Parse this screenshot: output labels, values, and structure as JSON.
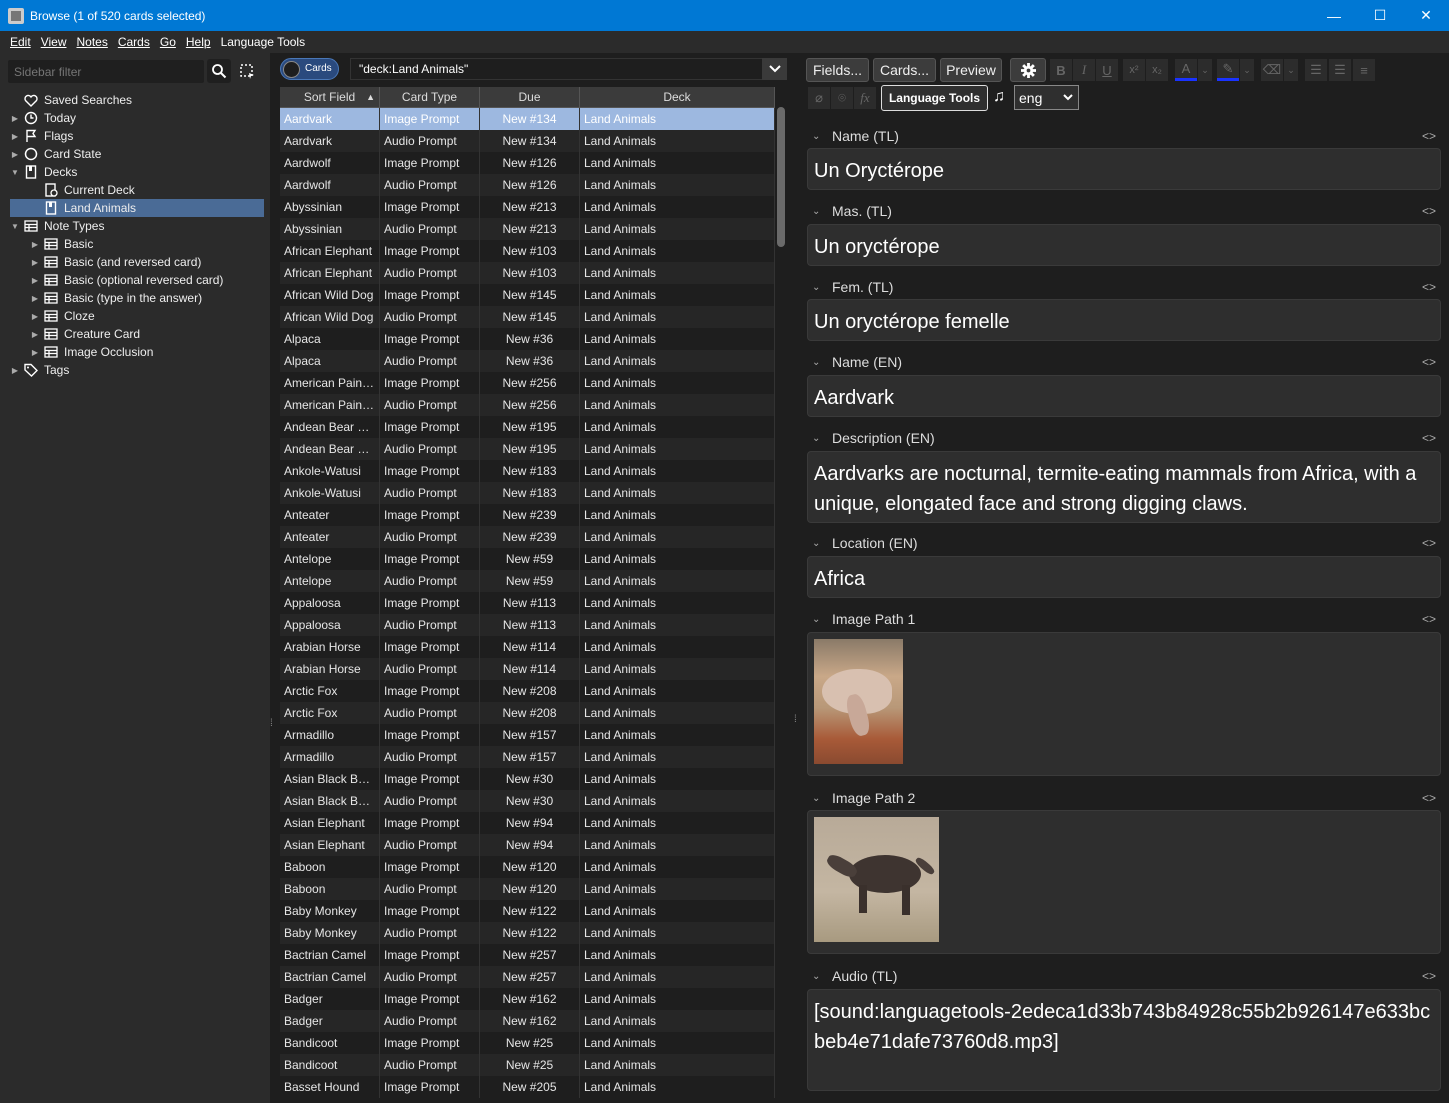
{
  "window": {
    "title": "Browse (1 of 520 cards selected)",
    "minimize": "—",
    "maximize": "☐",
    "close": "✕"
  },
  "menu": [
    "Edit",
    "View",
    "Notes",
    "Cards",
    "Go",
    "Help",
    "Language Tools"
  ],
  "sidebar": {
    "filter_placeholder": "Sidebar filter",
    "items": [
      {
        "label": "Saved Searches",
        "icon": "heart-icon",
        "arrow": "",
        "indent": 0
      },
      {
        "label": "Today",
        "icon": "clock-icon",
        "arrow": "▶",
        "indent": 0
      },
      {
        "label": "Flags",
        "icon": "flag-icon",
        "arrow": "▶",
        "indent": 0
      },
      {
        "label": "Card State",
        "icon": "circle-icon",
        "arrow": "▶",
        "indent": 0
      },
      {
        "label": "Decks",
        "icon": "deck-icon",
        "arrow": "▼",
        "indent": 0
      },
      {
        "label": "Current Deck",
        "icon": "current-deck-icon",
        "arrow": "",
        "indent": 1
      },
      {
        "label": "Land Animals",
        "icon": "deck-icon",
        "arrow": "",
        "indent": 1,
        "selected": true
      },
      {
        "label": "Note Types",
        "icon": "notetype-icon",
        "arrow": "▼",
        "indent": 0
      },
      {
        "label": "Basic",
        "icon": "notetype-icon",
        "arrow": "▶",
        "indent": 1
      },
      {
        "label": "Basic (and reversed card)",
        "icon": "notetype-icon",
        "arrow": "▶",
        "indent": 1
      },
      {
        "label": "Basic (optional reversed card)",
        "icon": "notetype-icon",
        "arrow": "▶",
        "indent": 1
      },
      {
        "label": "Basic (type in the answer)",
        "icon": "notetype-icon",
        "arrow": "▶",
        "indent": 1
      },
      {
        "label": "Cloze",
        "icon": "notetype-icon",
        "arrow": "▶",
        "indent": 1
      },
      {
        "label": "Creature Card",
        "icon": "notetype-icon",
        "arrow": "▶",
        "indent": 1
      },
      {
        "label": "Image Occlusion",
        "icon": "notetype-icon",
        "arrow": "▶",
        "indent": 1
      },
      {
        "label": "Tags",
        "icon": "tag-icon",
        "arrow": "▶",
        "indent": 0
      }
    ]
  },
  "toggle": {
    "label": "Cards"
  },
  "search": {
    "query": "\"deck:Land Animals\""
  },
  "table": {
    "headers": [
      "Sort Field",
      "Card Type",
      "Due",
      "Deck"
    ],
    "sort_indicator": "▲",
    "rows": [
      [
        "Aardvark",
        "Image Prompt",
        "New #134",
        "Land Animals"
      ],
      [
        "Aardvark",
        "Audio Prompt",
        "New #134",
        "Land Animals"
      ],
      [
        "Aardwolf",
        "Image Prompt",
        "New #126",
        "Land Animals"
      ],
      [
        "Aardwolf",
        "Audio Prompt",
        "New #126",
        "Land Animals"
      ],
      [
        "Abyssinian",
        "Image Prompt",
        "New #213",
        "Land Animals"
      ],
      [
        "Abyssinian",
        "Audio Prompt",
        "New #213",
        "Land Animals"
      ],
      [
        "African Elephant",
        "Image Prompt",
        "New #103",
        "Land Animals"
      ],
      [
        "African Elephant",
        "Audio Prompt",
        "New #103",
        "Land Animals"
      ],
      [
        "African Wild Dog",
        "Image Prompt",
        "New #145",
        "Land Animals"
      ],
      [
        "African Wild Dog",
        "Audio Prompt",
        "New #145",
        "Land Animals"
      ],
      [
        "Alpaca",
        "Image Prompt",
        "New #36",
        "Land Animals"
      ],
      [
        "Alpaca",
        "Audio Prompt",
        "New #36",
        "Land Animals"
      ],
      [
        "American Pain…",
        "Image Prompt",
        "New #256",
        "Land Animals"
      ],
      [
        "American Pain…",
        "Audio Prompt",
        "New #256",
        "Land Animals"
      ],
      [
        "Andean Bear …",
        "Image Prompt",
        "New #195",
        "Land Animals"
      ],
      [
        "Andean Bear …",
        "Audio Prompt",
        "New #195",
        "Land Animals"
      ],
      [
        "Ankole-Watusi",
        "Image Prompt",
        "New #183",
        "Land Animals"
      ],
      [
        "Ankole-Watusi",
        "Audio Prompt",
        "New #183",
        "Land Animals"
      ],
      [
        "Anteater",
        "Image Prompt",
        "New #239",
        "Land Animals"
      ],
      [
        "Anteater",
        "Audio Prompt",
        "New #239",
        "Land Animals"
      ],
      [
        "Antelope",
        "Image Prompt",
        "New #59",
        "Land Animals"
      ],
      [
        "Antelope",
        "Audio Prompt",
        "New #59",
        "Land Animals"
      ],
      [
        "Appaloosa",
        "Image Prompt",
        "New #113",
        "Land Animals"
      ],
      [
        "Appaloosa",
        "Audio Prompt",
        "New #113",
        "Land Animals"
      ],
      [
        "Arabian Horse",
        "Image Prompt",
        "New #114",
        "Land Animals"
      ],
      [
        "Arabian Horse",
        "Audio Prompt",
        "New #114",
        "Land Animals"
      ],
      [
        "Arctic Fox",
        "Image Prompt",
        "New #208",
        "Land Animals"
      ],
      [
        "Arctic Fox",
        "Audio Prompt",
        "New #208",
        "Land Animals"
      ],
      [
        "Armadillo",
        "Image Prompt",
        "New #157",
        "Land Animals"
      ],
      [
        "Armadillo",
        "Audio Prompt",
        "New #157",
        "Land Animals"
      ],
      [
        "Asian Black B…",
        "Image Prompt",
        "New #30",
        "Land Animals"
      ],
      [
        "Asian Black B…",
        "Audio Prompt",
        "New #30",
        "Land Animals"
      ],
      [
        "Asian Elephant",
        "Image Prompt",
        "New #94",
        "Land Animals"
      ],
      [
        "Asian Elephant",
        "Audio Prompt",
        "New #94",
        "Land Animals"
      ],
      [
        "Baboon",
        "Image Prompt",
        "New #120",
        "Land Animals"
      ],
      [
        "Baboon",
        "Audio Prompt",
        "New #120",
        "Land Animals"
      ],
      [
        "Baby Monkey",
        "Image Prompt",
        "New #122",
        "Land Animals"
      ],
      [
        "Baby Monkey",
        "Audio Prompt",
        "New #122",
        "Land Animals"
      ],
      [
        "Bactrian Camel",
        "Image Prompt",
        "New #257",
        "Land Animals"
      ],
      [
        "Bactrian Camel",
        "Audio Prompt",
        "New #257",
        "Land Animals"
      ],
      [
        "Badger",
        "Image Prompt",
        "New #162",
        "Land Animals"
      ],
      [
        "Badger",
        "Audio Prompt",
        "New #162",
        "Land Animals"
      ],
      [
        "Bandicoot",
        "Image Prompt",
        "New #25",
        "Land Animals"
      ],
      [
        "Bandicoot",
        "Audio Prompt",
        "New #25",
        "Land Animals"
      ],
      [
        "Basset Hound",
        "Image Prompt",
        "New #205",
        "Land Animals"
      ]
    ]
  },
  "editor": {
    "buttons": {
      "fields": "Fields...",
      "cards": "Cards...",
      "preview": "Preview",
      "lang_tools": "Language Tools",
      "lang_value": "eng"
    },
    "fields": [
      {
        "name": "Name (TL)",
        "value": "Un Oryctérope"
      },
      {
        "name": "Mas. (TL)",
        "value": "Un oryctérope"
      },
      {
        "name": "Fem. (TL)",
        "value": "Un oryctérope femelle"
      },
      {
        "name": "Name (EN)",
        "value": "Aardvark"
      },
      {
        "name": "Description (EN)",
        "value": "Aardvarks are nocturnal, termite-eating mammals from Africa, with a unique, elongated face and strong digging claws."
      },
      {
        "name": "Location (EN)",
        "value": "Africa"
      },
      {
        "name": "Image Path 1",
        "value": ""
      },
      {
        "name": "Image Path 2",
        "value": ""
      },
      {
        "name": "Audio (TL)",
        "value": "[sound:languagetools-2edeca1d33b743b84928c55b2b926147e633bcbeb4e71dafe73760d8.mp3]"
      }
    ],
    "code_toggle": "<>"
  }
}
